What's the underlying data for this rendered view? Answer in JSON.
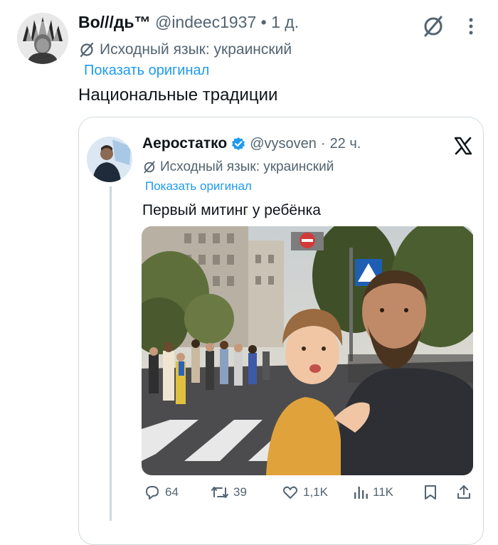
{
  "outer_tweet": {
    "author_name": "Во///дь™",
    "handle": "@indeec1937",
    "separator": "•",
    "time": "1 д.",
    "translation_note": "Исходный язык: украинский",
    "show_original": "Показать оригинал",
    "text": "Национальные традиции"
  },
  "quoted_tweet": {
    "author_name": "Аеростатко",
    "handle": "@vysoven",
    "separator": "·",
    "time": "22 ч.",
    "translation_note": "Исходный язык: украинский",
    "show_original": "Показать оригинал",
    "text": "Первый митинг у ребёнка"
  },
  "actions": {
    "replies": "64",
    "reposts": "39",
    "likes": "1,1K",
    "views": "11K"
  },
  "icons": [
    "grok-icon",
    "more-icon",
    "translate-icon",
    "verified-badge-icon",
    "x-logo-icon",
    "reply-icon",
    "repost-icon",
    "like-icon",
    "views-icon",
    "bookmark-icon",
    "share-icon"
  ],
  "colors": {
    "accent": "#1d9bf0",
    "muted": "#536471",
    "text": "#0f1419",
    "border": "#cfd9de"
  }
}
